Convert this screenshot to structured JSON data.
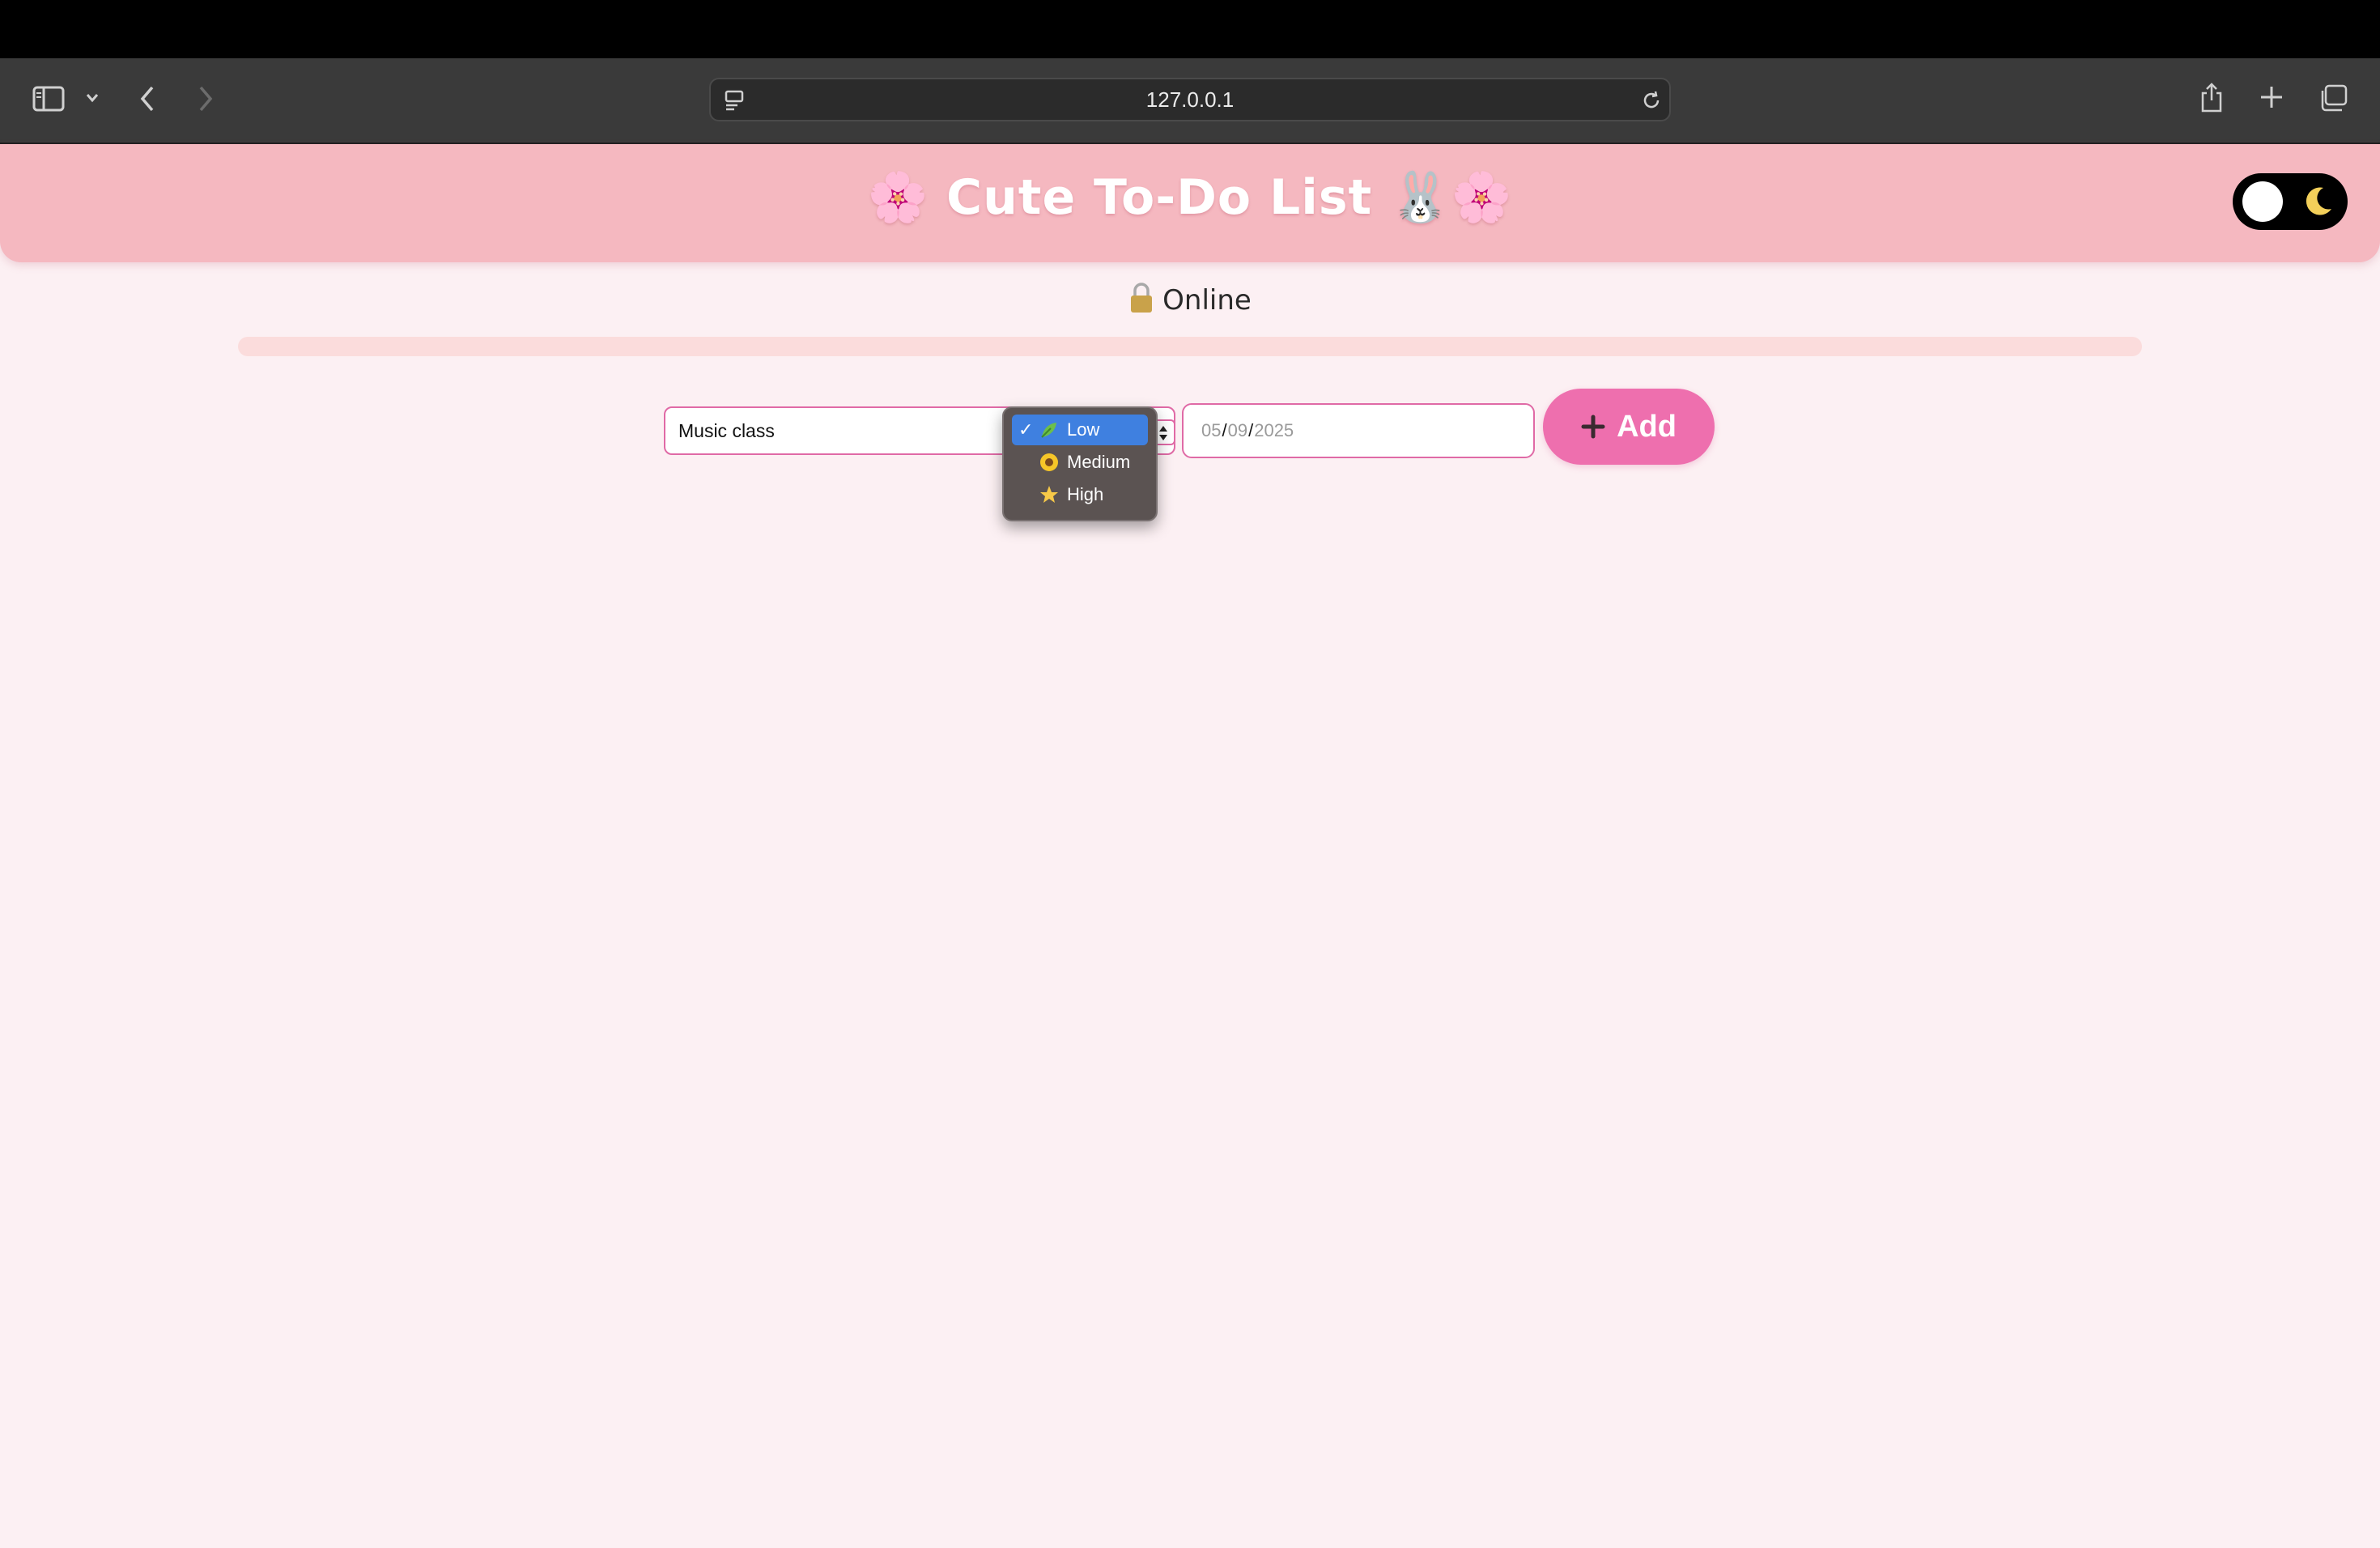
{
  "browser": {
    "url": "127.0.0.1"
  },
  "header": {
    "title": "🌸 Cute To-Do List 🐰🌸",
    "theme_toggle_icon": "moon-icon"
  },
  "status": {
    "text": "Online",
    "icon": "lock-icon"
  },
  "progress": {
    "fraction": 0
  },
  "form": {
    "task_value": "Music class",
    "priority_selected": "Low",
    "priority_options": [
      {
        "label": "Low",
        "icon": "leaf-icon"
      },
      {
        "label": "Medium",
        "icon": "sunflower-icon"
      },
      {
        "label": "High",
        "icon": "star-icon"
      }
    ],
    "date": {
      "month": "05",
      "day": "09",
      "year": "2025"
    },
    "add_label": "Add"
  },
  "colors": {
    "header_bg": "#f5b8c0",
    "accent": "#ee6fae",
    "page_bg": "#fcf0f3",
    "selected_option": "#3f80e0"
  }
}
